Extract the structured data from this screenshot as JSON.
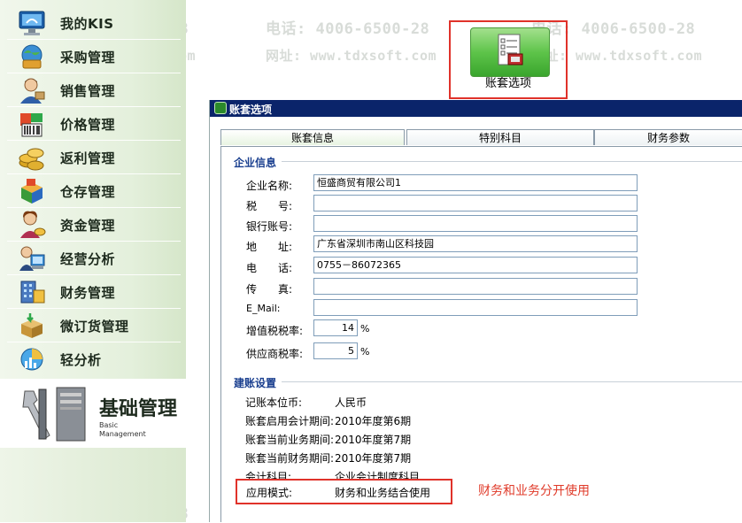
{
  "watermark": {
    "phone": "电话: 4006-6500-28",
    "site": "网址: www.tdxsoft.com"
  },
  "sidebar": {
    "items": [
      {
        "label": "我的KIS",
        "icon": "monitor-icon"
      },
      {
        "label": "采购管理",
        "icon": "globe-cart-icon"
      },
      {
        "label": "销售管理",
        "icon": "salesperson-icon"
      },
      {
        "label": "价格管理",
        "icon": "price-tag-icon"
      },
      {
        "label": "返利管理",
        "icon": "coins-icon"
      },
      {
        "label": "仓存管理",
        "icon": "warehouse-boxes-icon"
      },
      {
        "label": "资金管理",
        "icon": "money-person-icon"
      },
      {
        "label": "经营分析",
        "icon": "analyst-icon"
      },
      {
        "label": "财务管理",
        "icon": "finance-building-icon"
      },
      {
        "label": "微订货管理",
        "icon": "order-box-icon"
      },
      {
        "label": "轻分析",
        "icon": "pie-chart-icon"
      }
    ],
    "active": {
      "title": "基础管理",
      "subtitle_line1": "Basic",
      "subtitle_line2": "Management",
      "icon": "tools-computer-icon"
    }
  },
  "toolbar": {
    "button_label": "账套选项",
    "icon": "checklist-icon"
  },
  "dialog": {
    "title": "账套选项",
    "tabs": [
      "账套信息",
      "特别科目",
      "财务参数"
    ],
    "active_tab": 0,
    "company_group": {
      "title": "企业信息",
      "fields": [
        {
          "label": "企业名称:",
          "value": "恒盛商贸有限公司1"
        },
        {
          "label": "税　　号:",
          "value": ""
        },
        {
          "label": "银行账号:",
          "value": ""
        },
        {
          "label": "地　　址:",
          "value": "广东省深圳市南山区科技园"
        },
        {
          "label": "电　　话:",
          "value": "0755－86072365"
        },
        {
          "label": "传　　真:",
          "value": ""
        },
        {
          "label": "E_Mail:",
          "value": ""
        }
      ],
      "vat_label": "增值税税率:",
      "vat_value": "14",
      "vat_unit": "%",
      "supplier_label": "供应商税率:",
      "supplier_value": "5",
      "supplier_unit": "%"
    },
    "setup_group": {
      "title": "建账设置",
      "rows": [
        {
          "label": "记账本位币:",
          "value": "人民币"
        },
        {
          "label": "账套启用会计期间:",
          "value": "2010年度第6期"
        },
        {
          "label": "账套当前业务期间:",
          "value": "2010年度第7期"
        },
        {
          "label": "账套当前财务期间:",
          "value": "2010年度第7期"
        },
        {
          "label": "会计科目:",
          "value": "企业会计制度科目"
        }
      ],
      "mode_label": "应用模式:",
      "mode_value": "财务和业务结合使用"
    }
  },
  "annotation": "财务和业务分开使用"
}
